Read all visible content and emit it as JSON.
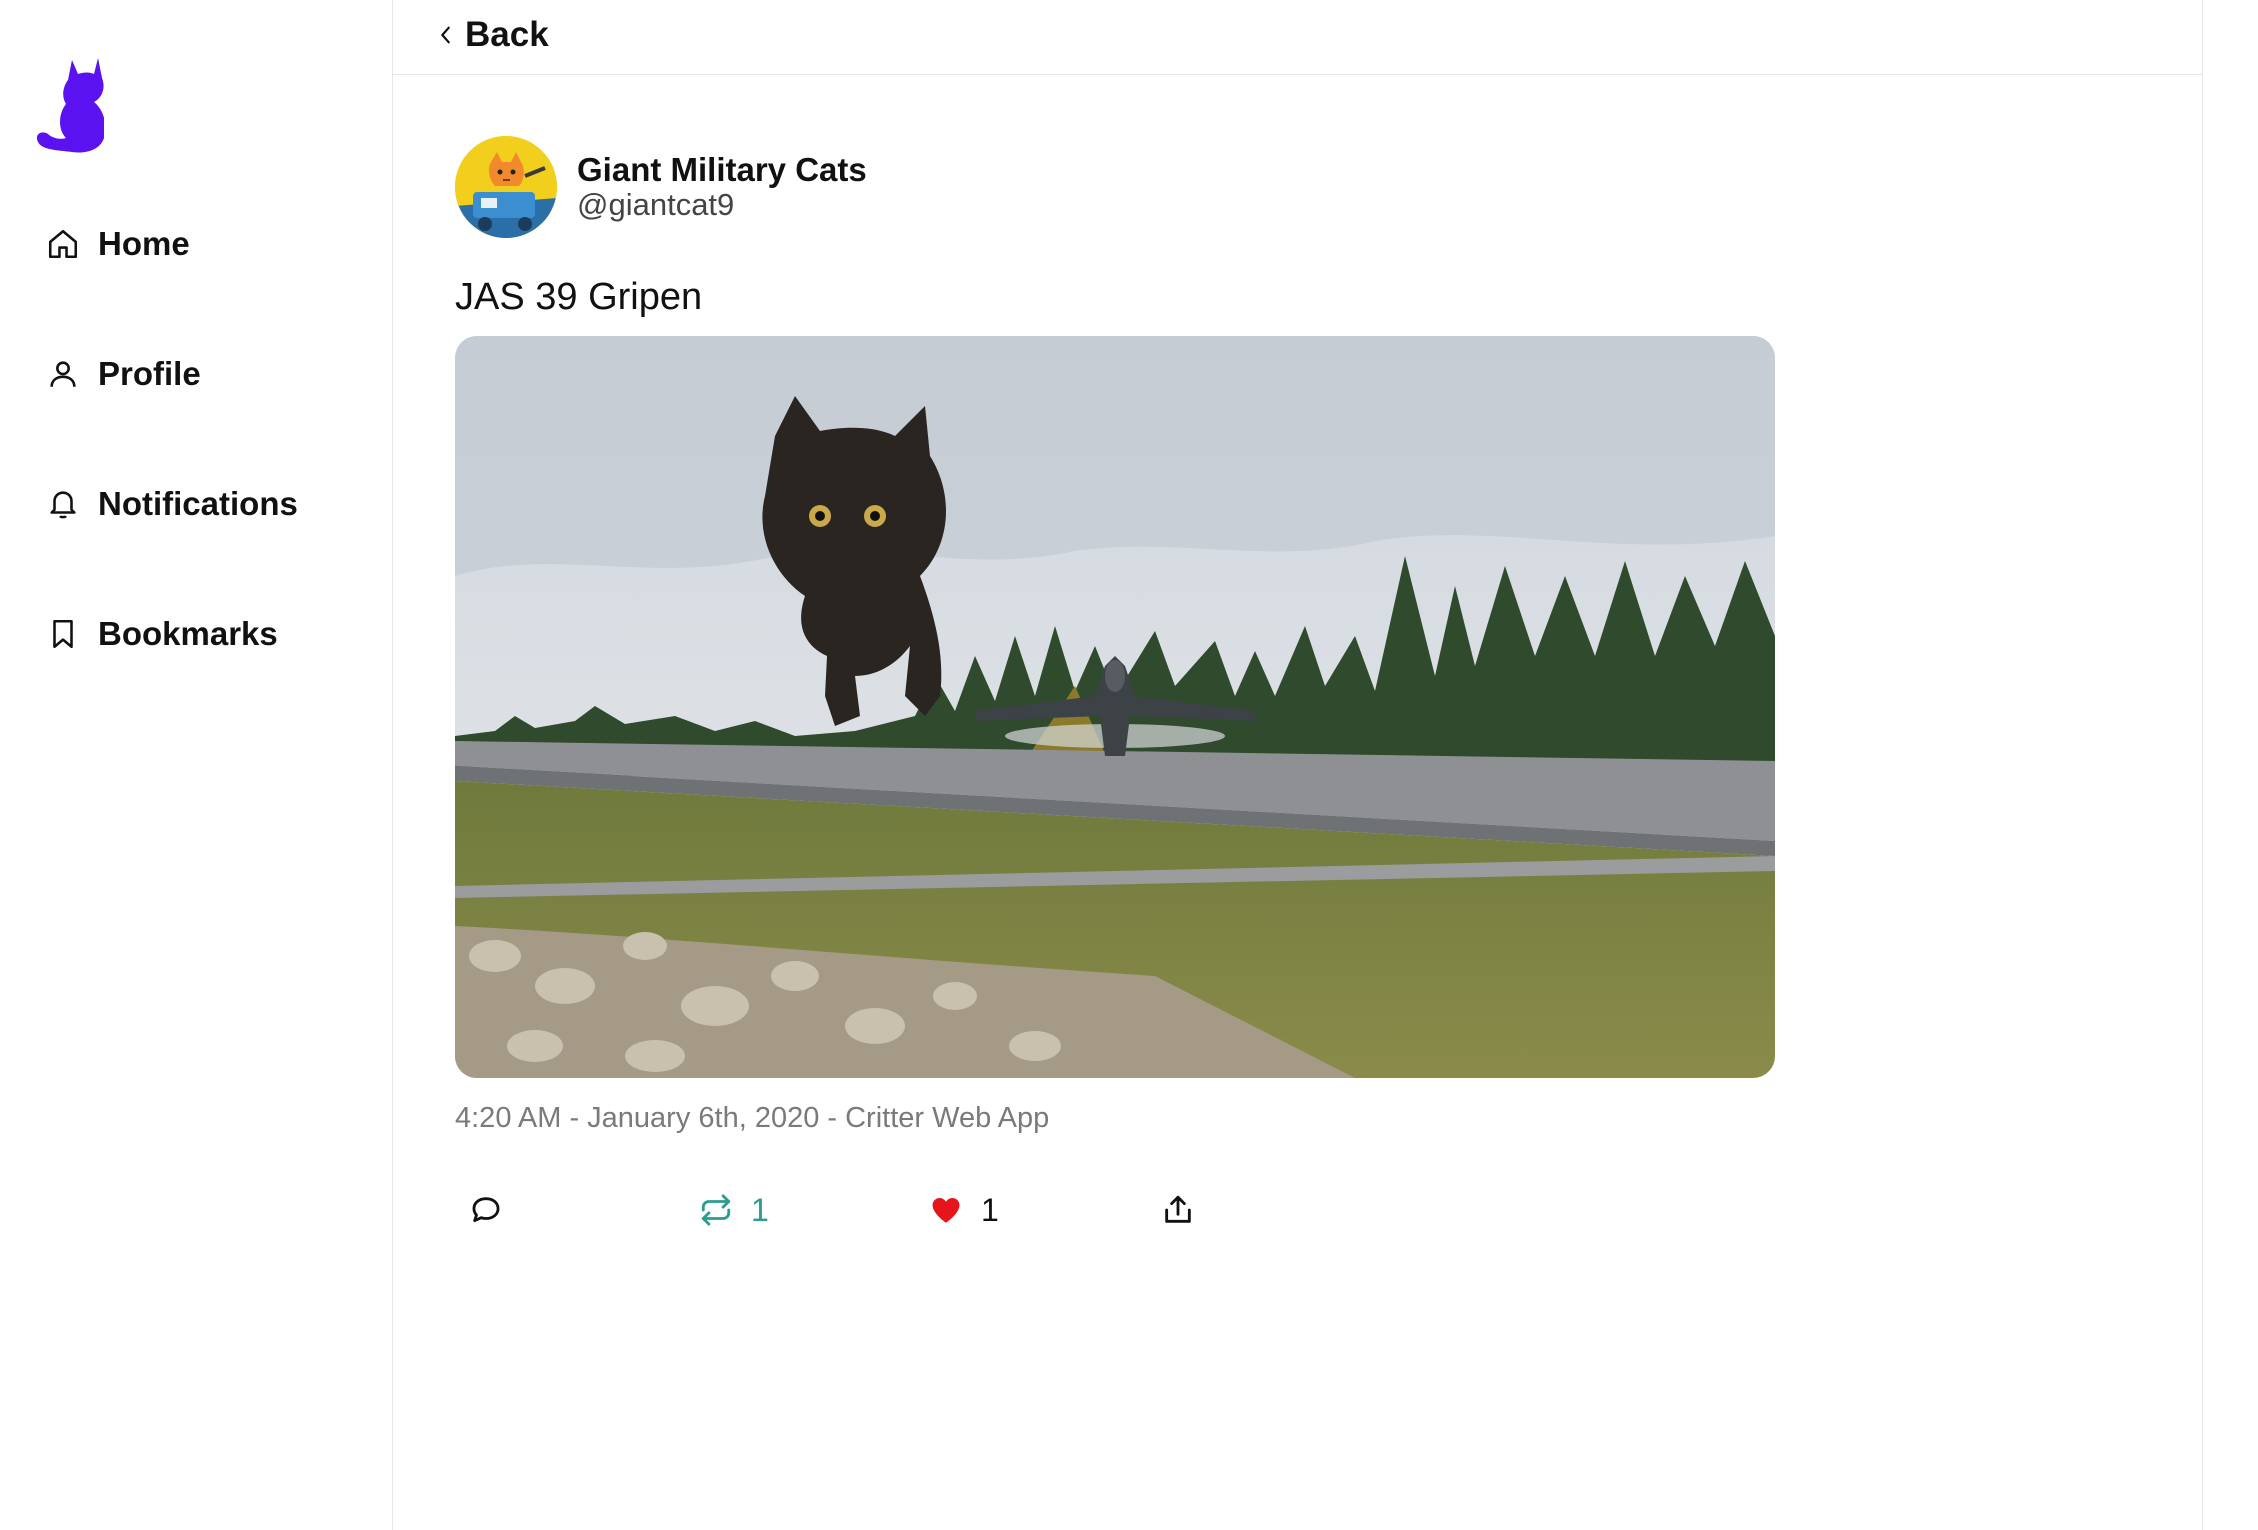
{
  "app": {
    "logo_icon": "cat-logo-icon",
    "accent_color": "#5a12f0"
  },
  "sidebar": {
    "items": [
      {
        "label": "Home",
        "icon": "home-icon"
      },
      {
        "label": "Profile",
        "icon": "user-icon"
      },
      {
        "label": "Notifications",
        "icon": "bell-icon"
      },
      {
        "label": "Bookmarks",
        "icon": "bookmark-icon"
      }
    ]
  },
  "header": {
    "back_label": "Back",
    "back_icon": "chevron-left-icon"
  },
  "post": {
    "author_name": "Giant Military Cats",
    "author_handle": "@giantcat9",
    "text": "JAS 39 Gripen",
    "meta": "4:20 AM - January 6th, 2020 - Critter Web App",
    "actions": {
      "reply_icon": "comment-icon",
      "repost_icon": "repost-icon",
      "repost_count": "1",
      "repost_color": "#2a9d8f",
      "like_icon": "heart-icon",
      "like_count": "1",
      "like_color": "#e8141c",
      "share_icon": "share-icon"
    }
  }
}
